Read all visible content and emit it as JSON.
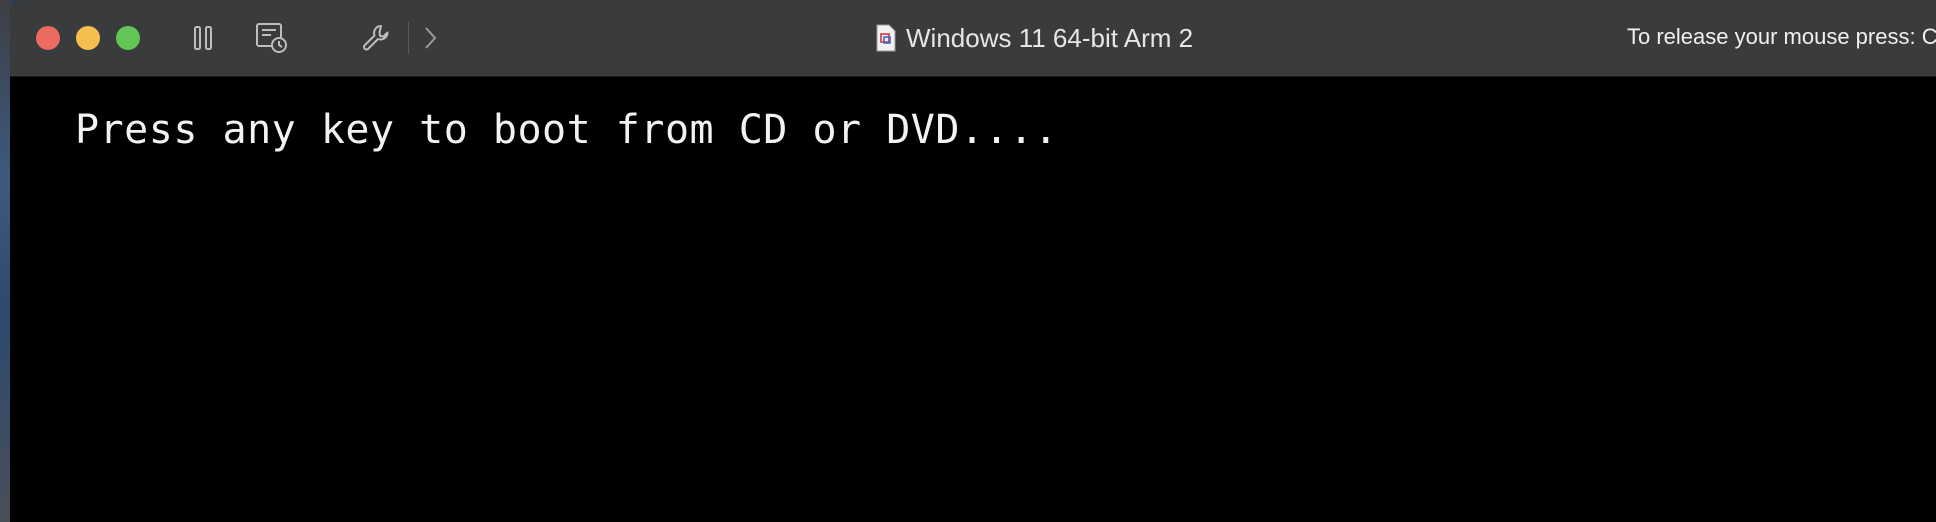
{
  "window": {
    "title": "Windows 11 64-bit Arm 2",
    "release_hint": "To release your mouse press: C"
  },
  "toolbar": {
    "buttons": [
      {
        "name": "pause-icon"
      },
      {
        "name": "snapshot-icon"
      },
      {
        "name": "wrench-icon"
      },
      {
        "name": "chevron-right-icon"
      }
    ]
  },
  "console": {
    "text": "Press any key to boot from CD or DVD...."
  },
  "colors": {
    "close": "#ed6a5e",
    "minimize": "#f5bf4f",
    "maximize": "#62c554",
    "titlebar": "#3a3b3d",
    "console_bg": "#000000"
  }
}
